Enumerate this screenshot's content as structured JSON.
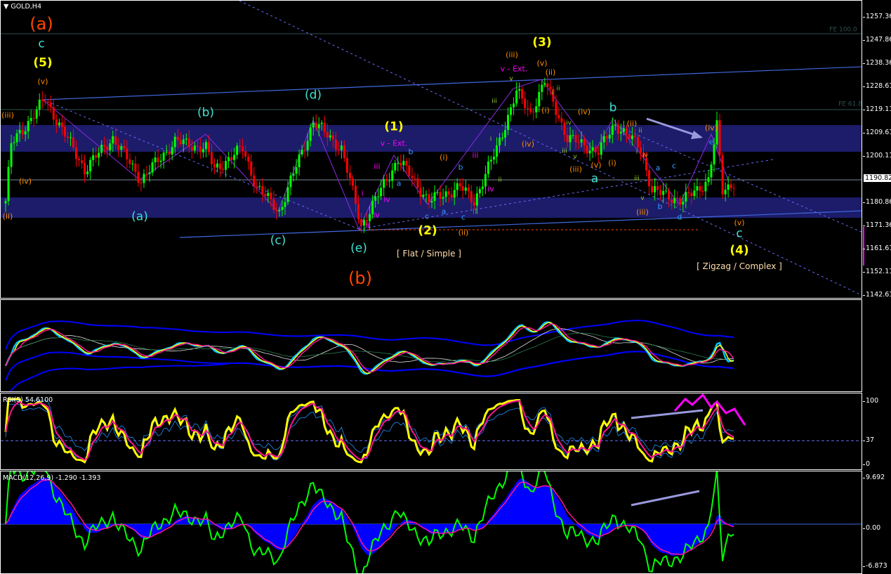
{
  "header": {
    "symbol_label": "GOLD,H4"
  },
  "chart_data": {
    "type": "candlestick",
    "symbol": "GOLD",
    "timeframe": "H4",
    "price_axis_ticks": [
      "1257.36",
      "1247.86",
      "1238.36",
      "1228.61",
      "1219.11",
      "1209.61",
      "1200.11",
      "1190.82",
      "1180.86",
      "1171.36",
      "1161.61",
      "1152.11",
      "1142.61"
    ],
    "price_range": [
      1142.61,
      1257.36
    ],
    "current_price": "1190.82",
    "price_path_waypoints": [
      [
        0,
        1181.7
      ],
      [
        2,
        1204.9
      ],
      [
        14,
        1223.7
      ],
      [
        28,
        1194.7
      ],
      [
        38,
        1207.8
      ],
      [
        48,
        1190.4
      ],
      [
        60,
        1206.3
      ],
      [
        71,
        1203.4
      ],
      [
        74,
        1194.7
      ],
      [
        84,
        1203.4
      ],
      [
        89,
        1187.5
      ],
      [
        97,
        1177.4
      ],
      [
        109,
        1214.4
      ],
      [
        119,
        1203.4
      ],
      [
        126,
        1171.5
      ],
      [
        139,
        1199.0
      ],
      [
        150,
        1181.7
      ],
      [
        161,
        1187.5
      ],
      [
        166,
        1181.7
      ],
      [
        174,
        1203.4
      ],
      [
        181,
        1226.6
      ],
      [
        186,
        1217.9
      ],
      [
        191,
        1230.9
      ],
      [
        199,
        1207.8
      ],
      [
        210,
        1202.0
      ],
      [
        216,
        1213.6
      ],
      [
        225,
        1203.4
      ],
      [
        229,
        1186.0
      ],
      [
        240,
        1181.7
      ],
      [
        249,
        1190.4
      ],
      [
        252,
        1212.2
      ],
      [
        254,
        1186.0
      ],
      [
        258,
        1189.6
      ]
    ],
    "fibonacci_levels": [
      {
        "label": "FE 100.0",
        "price": 1250.5
      },
      {
        "label": "FE 61.8",
        "price": 1221.0
      }
    ],
    "zones": [
      [
        1201.5,
        1212.6
      ],
      [
        1176.0,
        1184.4
      ]
    ],
    "wave_labels": {
      "primary": [
        "(a)",
        "(b)"
      ],
      "intermediate": [
        "c",
        "(b)",
        "(d)",
        "(a)",
        "(c)",
        "(e)",
        "b",
        "a",
        "c"
      ],
      "minor": [
        "(5)",
        "(3)",
        "(1)",
        "(2)",
        "(4)"
      ],
      "minute": [
        "(v)",
        "(iii)",
        "(iv)",
        "(ii)",
        "(iii)",
        "(v)",
        "(ii)",
        "(i)",
        "(iv)",
        "(iv)",
        "(iii)",
        "(v)",
        "(i)",
        "(ii)",
        "(iii)",
        "(iv)",
        "(v)",
        "(i)",
        "(ii)"
      ],
      "extension": [
        "v - Ext.",
        "v - Ext."
      ],
      "minuette_magenta": [
        "iii",
        "iv",
        "iv",
        "i",
        "ii",
        "iii",
        "iv",
        "ii"
      ],
      "abc_blue": [
        "b",
        "a",
        "b",
        "c",
        "a",
        "c",
        "a",
        "c",
        "b",
        "d",
        "e"
      ],
      "sub_minuette": [
        "iii",
        "i",
        "ii",
        "v",
        "i",
        "ii",
        "iii",
        "iv",
        "v",
        "ii",
        "i",
        "iv",
        "iii",
        "v"
      ]
    },
    "annotations": [
      "[ Flat / Simple ]",
      "[ Zigzag / Complex ]"
    ],
    "indicators": [
      {
        "name": "moving-average-ribbon"
      },
      {
        "name": "RSI",
        "title": "RSI(5) 54.6100",
        "ticks": [
          "100",
          "37",
          "0"
        ],
        "range": [
          0,
          100
        ],
        "level": 37
      },
      {
        "name": "MACD",
        "title": "MACD(12,26,9) -1.290 -1.393",
        "ticks": [
          "9.692",
          "0.00",
          "-6.873"
        ],
        "range": [
          -6.873,
          9.692
        ]
      }
    ],
    "colors": {
      "bull": "#00ff00",
      "bear": "#ff0000",
      "zone": "#1c1c6a",
      "rsi": "#ffff00",
      "signal": "#ff1493",
      "band": "#1e90ff",
      "macd_hist": "#0000ff",
      "macd_line": "#00ff00"
    }
  }
}
